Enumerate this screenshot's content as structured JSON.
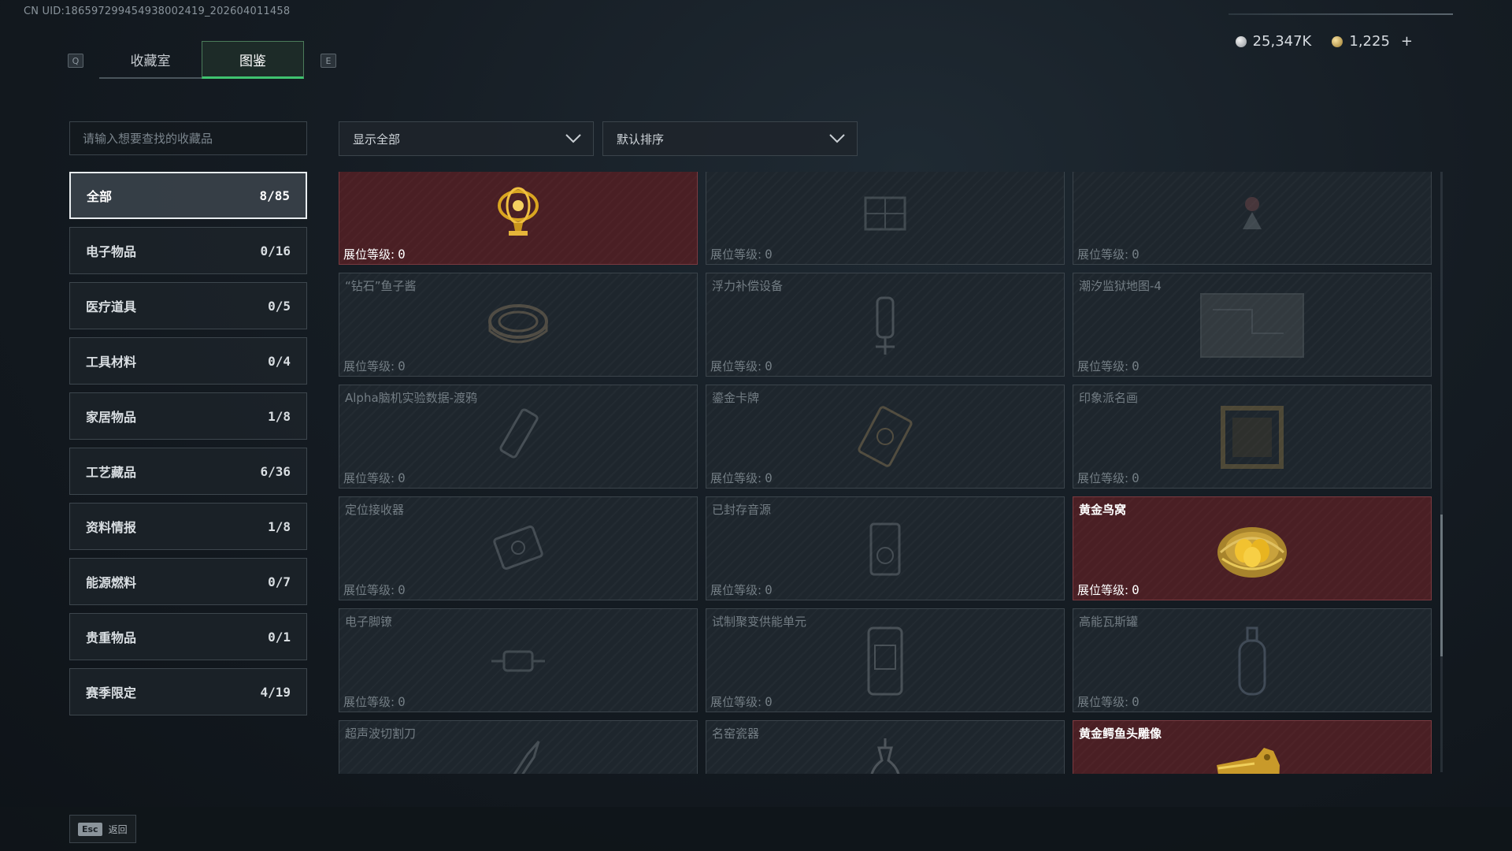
{
  "uid_text": "CN UID:1865972994549380024​19_202604011458",
  "keys": {
    "left": "Q",
    "right": "E"
  },
  "tabs": [
    {
      "label": "收藏室",
      "active": false
    },
    {
      "label": "图鉴",
      "active": true
    }
  ],
  "currency": {
    "silver": "25,347K",
    "gold": "1,225",
    "plus": "+"
  },
  "search": {
    "placeholder": "请输入想要查找的收藏品"
  },
  "filters": {
    "show": "显示全部",
    "sort": "默认排序"
  },
  "categories": [
    {
      "label": "全部",
      "count": "8/85",
      "active": true
    },
    {
      "label": "电子物品",
      "count": "0/16"
    },
    {
      "label": "医疗道具",
      "count": "0/5"
    },
    {
      "label": "工具材料",
      "count": "0/4"
    },
    {
      "label": "家居物品",
      "count": "1/8"
    },
    {
      "label": "工艺藏品",
      "count": "6/36"
    },
    {
      "label": "资料情报",
      "count": "1/8"
    },
    {
      "label": "能源燃料",
      "count": "0/7"
    },
    {
      "label": "贵重物品",
      "count": "0/1"
    },
    {
      "label": "赛季限定",
      "count": "4/19"
    }
  ],
  "level_label": "展位等级:",
  "items": [
    {
      "name": "",
      "level": "0",
      "owned": true,
      "icon": "golden-trophy-icon"
    },
    {
      "name": "",
      "level": "0",
      "owned": false,
      "icon": "chessboard-icon"
    },
    {
      "name": "",
      "level": "0",
      "owned": false,
      "icon": "figure-icon"
    },
    {
      "name": "“钻石”鱼子酱",
      "level": "0",
      "owned": false,
      "icon": "caviar-tin-icon"
    },
    {
      "name": "浮力补偿设备",
      "level": "0",
      "owned": false,
      "icon": "diving-gear-icon"
    },
    {
      "name": "潮汐监狱地图-4",
      "level": "0",
      "owned": false,
      "icon": "map-icon"
    },
    {
      "name": "Alpha脑机实验数据-渡鸦",
      "level": "0",
      "owned": false,
      "icon": "usb-drive-icon"
    },
    {
      "name": "鎏金卡牌",
      "level": "0",
      "owned": false,
      "icon": "card-icon"
    },
    {
      "name": "印象派名画",
      "level": "0",
      "owned": false,
      "icon": "painting-icon"
    },
    {
      "name": "定位接收器",
      "level": "0",
      "owned": false,
      "icon": "receiver-icon"
    },
    {
      "name": "已封存音源",
      "level": "0",
      "owned": false,
      "icon": "audio-source-icon"
    },
    {
      "name": "黄金鸟窝",
      "level": "0",
      "owned": true,
      "icon": "golden-nest-icon"
    },
    {
      "name": "电子脚镣",
      "level": "0",
      "owned": false,
      "icon": "ankle-monitor-icon"
    },
    {
      "name": "试制聚变供能单元",
      "level": "0",
      "owned": false,
      "icon": "fusion-cell-icon"
    },
    {
      "name": "高能瓦斯罐",
      "level": "0",
      "owned": false,
      "icon": "gas-canister-icon"
    },
    {
      "name": "超声波切割刀",
      "level": "",
      "owned": false,
      "icon": "ultrasonic-knife-icon"
    },
    {
      "name": "名窑瓷器",
      "level": "",
      "owned": false,
      "icon": "porcelain-vase-icon"
    },
    {
      "name": "黄金鳄鱼头雕像",
      "level": "",
      "owned": true,
      "icon": "golden-crocodile-head-icon"
    }
  ],
  "footer": {
    "key": "Esc",
    "label": "返回"
  }
}
